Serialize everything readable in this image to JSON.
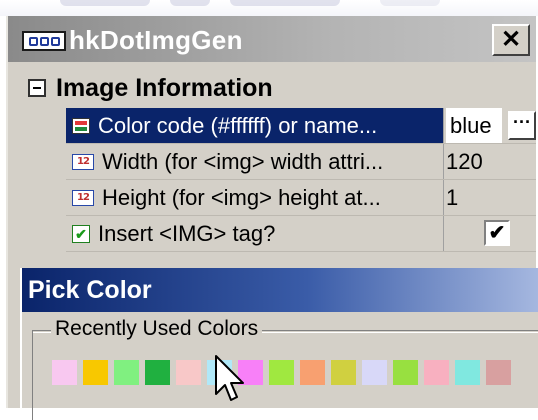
{
  "main_window": {
    "title": "hkDotImgGen",
    "close_label": "✕"
  },
  "property_grid": {
    "section_title": "Image Information",
    "rows": [
      {
        "name": "Color code (#ffffff) or name...",
        "value": "blue",
        "icon": "color-property-icon",
        "selected": true
      },
      {
        "name": "Width (for <img> width attri...",
        "value": "120",
        "icon": "numeric-property-icon",
        "icon_text": "12"
      },
      {
        "name": "Height (for <img> height at...",
        "value": "1",
        "icon": "numeric-property-icon",
        "icon_text": "12"
      },
      {
        "name": "Insert <IMG> tag?",
        "value": "✔",
        "icon": "boolean-property-icon"
      }
    ],
    "ellipsis_label": "···"
  },
  "pick_color": {
    "title": "Pick Color",
    "recent_label": "Recently Used Colors",
    "swatches": [
      "#f8c8f0",
      "#f8c800",
      "#80f080",
      "#20b040",
      "#f8c8c8",
      "#b0e8f8",
      "#f880f8",
      "#a0e840",
      "#f8a070",
      "#d0d040",
      "#d8d8f8",
      "#98e040",
      "#f8b0c0",
      "#80e8e0",
      "#d8a0a0"
    ]
  },
  "colors": {
    "selection": "#0a246a",
    "titlebar_active": "#0a246a",
    "chrome": "#d4d0c8"
  }
}
